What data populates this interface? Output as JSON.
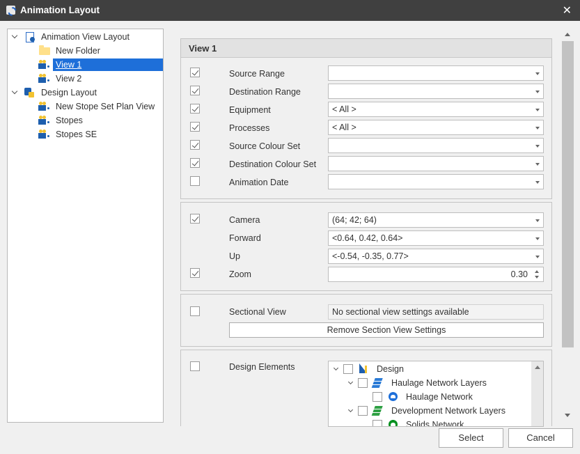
{
  "window": {
    "title": "Animation Layout",
    "close_glyph": "✕",
    "app_icon": "animation-app-icon"
  },
  "tree": {
    "nodes": [
      {
        "label": "Animation View Layout",
        "icon": "animation-layout-icon",
        "expanded": true
      },
      {
        "label": "New Folder",
        "icon": "folder-icon"
      },
      {
        "label": "View 1",
        "icon": "camera-icon",
        "selected": true
      },
      {
        "label": "View 2",
        "icon": "camera-icon"
      },
      {
        "label": "Design Layout",
        "icon": "design-layout-icon",
        "expanded": true
      },
      {
        "label": "New Stope Set Plan View",
        "icon": "camera-icon"
      },
      {
        "label": "Stopes",
        "icon": "camera-icon"
      },
      {
        "label": "Stopes SE",
        "icon": "camera-icon"
      }
    ]
  },
  "view_panel": {
    "title": "View 1",
    "rows": [
      {
        "label": "Source Range",
        "checked": true,
        "value": ""
      },
      {
        "label": "Destination Range",
        "checked": true,
        "value": ""
      },
      {
        "label": "Equipment",
        "checked": true,
        "value": "< All >"
      },
      {
        "label": "Processes",
        "checked": true,
        "value": "< All >"
      },
      {
        "label": "Source Colour Set",
        "checked": true,
        "value": ""
      },
      {
        "label": "Destination Colour Set",
        "checked": true,
        "value": ""
      },
      {
        "label": "Animation Date",
        "checked": false,
        "value": ""
      }
    ]
  },
  "camera_panel": {
    "camera": {
      "label": "Camera",
      "checked": true,
      "value": "(64; 42; 64)"
    },
    "forward": {
      "label": "Forward",
      "value": "<0.64, 0.42, 0.64>"
    },
    "up": {
      "label": "Up",
      "value": "<-0.54, -0.35, 0.77>"
    },
    "zoom": {
      "label": "Zoom",
      "checked": true,
      "value": "0.30"
    }
  },
  "section_panel": {
    "label": "Sectional View",
    "checked": false,
    "info": "No sectional view settings available",
    "remove_label": "Remove Section View Settings"
  },
  "design_panel": {
    "label": "Design Elements",
    "checked": false,
    "tree": [
      {
        "label": "Design",
        "icon": "design-icon"
      },
      {
        "label": "Haulage Network Layers",
        "icon": "layers-icon"
      },
      {
        "label": "Haulage Network",
        "icon": "haulage-network-icon"
      },
      {
        "label": "Development Network Layers",
        "icon": "layers-green-icon"
      },
      {
        "label": "Solids Network",
        "icon": "solids-network-icon"
      }
    ]
  },
  "footer": {
    "select_label": "Select",
    "cancel_label": "Cancel"
  }
}
